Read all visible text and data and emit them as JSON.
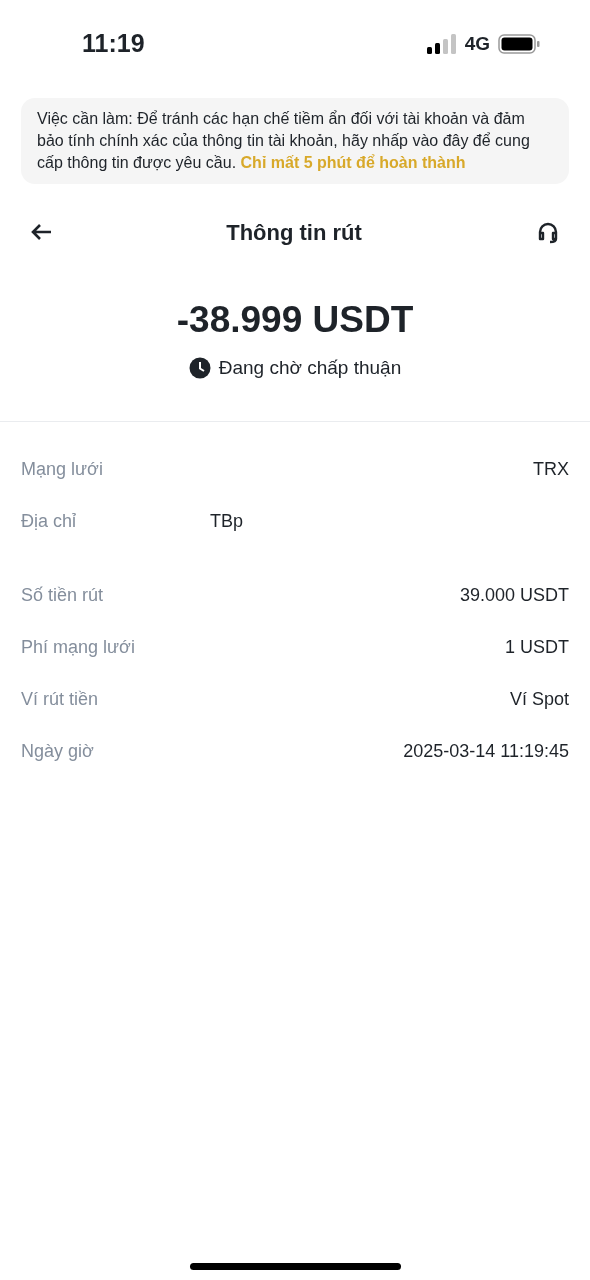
{
  "status_bar": {
    "time": "11:19",
    "network": "4G"
  },
  "notice": {
    "text": "Việc cần làm: Để tránh các hạn chế tiềm ẩn đối với tài khoản và đảm bảo tính chính xác của thông tin tài khoản, hãy nhấp vào đây để cung cấp thông tin được yêu cầu.",
    "link": "Chỉ mất 5 phút để hoàn thành"
  },
  "header": {
    "title": "Thông tin rút"
  },
  "amount": "-38.999 USDT",
  "status": "Đang chờ chấp thuận",
  "details": [
    {
      "label": "Mạng lưới",
      "value": "TRX",
      "kind": "plain"
    },
    {
      "label": "Địa chỉ",
      "value": "TBp",
      "kind": "address"
    },
    {
      "label": "Số tiền rút",
      "value": "39.000 USDT",
      "kind": "plain"
    },
    {
      "label": "Phí mạng lưới",
      "value": "1 USDT",
      "kind": "plain"
    },
    {
      "label": "Ví rút tiền",
      "value": "Ví Spot",
      "kind": "plain"
    },
    {
      "label": "Ngày giờ",
      "value": "2025-03-14 11:19:45",
      "kind": "plain"
    }
  ]
}
